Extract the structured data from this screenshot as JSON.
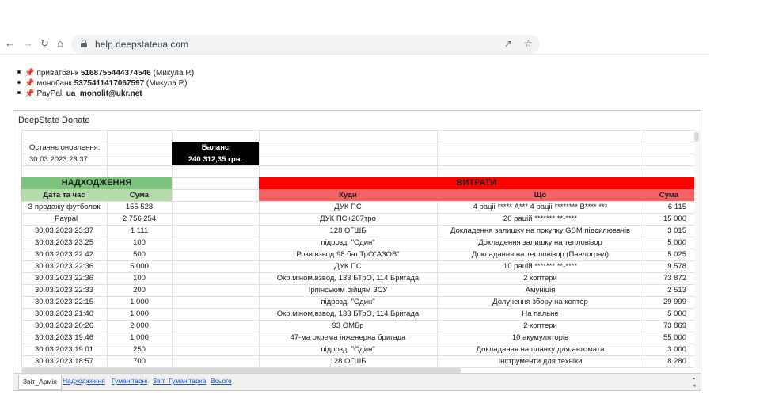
{
  "browser": {
    "url": "help.deepstateua.com",
    "icons": [
      "back-arrow-icon",
      "forward-arrow-icon",
      "reload-icon",
      "home-icon",
      "lock-icon",
      "share-icon",
      "star-icon"
    ]
  },
  "donations": [
    {
      "name": "приватбанк ",
      "account": "5168755444374546",
      "owner": " (Микула Р.)"
    },
    {
      "name": "монобанк ",
      "account": "5375411417067597",
      "owner": " (Микула Р.)"
    },
    {
      "name": "PayPal: ",
      "account": "ua_monolit@ukr.net",
      "owner": ""
    }
  ],
  "sheet": {
    "title": "DeepState Donate",
    "last_update_label": "Останнє оновлення:",
    "last_update_value": "30.03.2023 23:37",
    "balance_label": "Баланс",
    "balance_value": "240 312,35 грн.",
    "income_header": "НАДХОДЖЕННЯ",
    "expense_header": "ВИТРАТИ",
    "income_columns": [
      "Дата та час",
      "Сума"
    ],
    "expense_columns": [
      "Куди",
      "Що",
      "Сума"
    ],
    "colors": {
      "income_header": "#7dc57d",
      "income_cols": "#b6dcae",
      "expense_header": "#ff0000",
      "expense_cols": "#f36363",
      "balance_bg": "#000000"
    },
    "rows": [
      {
        "date": "З продажу футболок",
        "income": "155 528",
        "where": "ДУК ПС",
        "what": "4 раціі ***** А*** 4 раціі ******** В**** ***",
        "amount": "6 115"
      },
      {
        "date": "_Paypal",
        "income": "2 756 254",
        "where": "ДУК ПС+207тро",
        "what": "20 рацій ******* **-****",
        "amount": "15 000"
      },
      {
        "date": "30.03.2023 23:37",
        "income": "1 111",
        "where": "128 ОГШБ",
        "what": "Докладення залишку на покупку GSM підсилювачів",
        "amount": "3 015"
      },
      {
        "date": "30.03.2023 23:25",
        "income": "100",
        "where": "підрозд. \"Один\"",
        "what": "Докладення залишку на тепловізор",
        "amount": "5 000"
      },
      {
        "date": "30.03.2023 22:42",
        "income": "500",
        "where": "Розв.взвод 98 бат.ТрО\"АЗОВ\"",
        "what": "Докладання на тепловізор (Павлоград)",
        "amount": "5 025"
      },
      {
        "date": "30.03.2023 22:36",
        "income": "5 000",
        "where": "ДУК ПС",
        "what": "10 рацій ******* **-****",
        "amount": "9 578"
      },
      {
        "date": "30.03.2023 22:36",
        "income": "100",
        "where": "Окр.мiном.взвод, 133 БТрО, 114 Бригада",
        "what": "2 коптери",
        "amount": "73 872"
      },
      {
        "date": "30.03.2023 22:33",
        "income": "200",
        "where": "Ірпінським бійцям ЗСУ",
        "what": "Амуніція",
        "amount": "2 513"
      },
      {
        "date": "30.03.2023 22:15",
        "income": "1 000",
        "where": "підрозд. \"Один\"",
        "what": "Долучення збору на коптер",
        "amount": "29 999"
      },
      {
        "date": "30.03.2023 21:40",
        "income": "1 000",
        "where": "Окр.мiном.взвод, 133 БТрО, 114 Бригада",
        "what": "На пальне",
        "amount": "5 000"
      },
      {
        "date": "30.03.2023 20:26",
        "income": "2 000",
        "where": "93 ОМБр",
        "what": "2 коптери",
        "amount": "73 869"
      },
      {
        "date": "30.03.2023 19:46",
        "income": "1 000",
        "where": "47-ма окрема інженерна бригада",
        "what": "10 акумуляторів",
        "amount": "55 000"
      },
      {
        "date": "30.03.2023 19:01",
        "income": "250",
        "where": "підрозд. \"Один\"",
        "what": "Докладання на планку для автомата",
        "amount": "3 000"
      },
      {
        "date": "30.03.2023 18:57",
        "income": "700",
        "where": "128 ОГШБ",
        "what": "Інструменти для техніки",
        "amount": "8 280"
      }
    ],
    "tabs": [
      "Звіт_Армія",
      "Надходження",
      "Гуманітарні",
      "Звіт_Гуманітарка",
      "Всього"
    ],
    "active_tab": 0
  }
}
